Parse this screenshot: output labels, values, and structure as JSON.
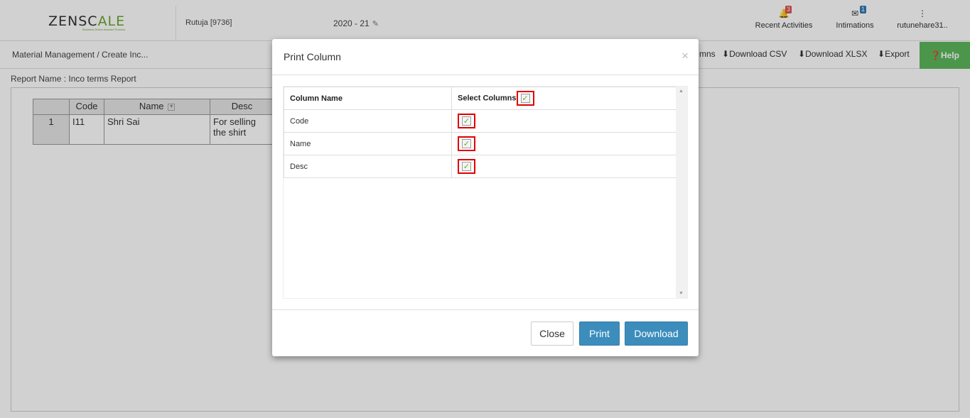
{
  "header": {
    "logo_prefix": "ZENSC",
    "logo_mid": "ALE",
    "logo_tagline": "Business Driven Assured Process",
    "user": "Rutuja [9736]",
    "year": "2020 - 21",
    "nav": {
      "recent_activities": "Recent Activities",
      "recent_count": "3",
      "intimations": "Intimations",
      "intimations_count": "1",
      "account": "rutunehare31.."
    }
  },
  "subbar": {
    "breadcrumb": "Material Management  / Create Inc...",
    "columns_partial": "mns",
    "download_csv": "Download CSV",
    "download_xlsx": "Download XLSX",
    "export": "Export",
    "help": "Help"
  },
  "report": {
    "name_label": "Report Name : Inco terms Report",
    "headers": [
      "Code",
      "Name",
      "Desc"
    ],
    "rows": [
      {
        "index": "1",
        "code": "I11",
        "name": "Shri Sai",
        "desc": "For selling the shirt"
      }
    ]
  },
  "modal": {
    "title": "Print Column",
    "close_symbol": "×",
    "col_header": "Column Name",
    "select_header": "Select Columns",
    "columns": [
      {
        "name": "Code",
        "checked": true
      },
      {
        "name": "Name",
        "checked": true
      },
      {
        "name": "Desc",
        "checked": true
      }
    ],
    "close_label": "Close",
    "print_label": "Print",
    "download_label": "Download"
  },
  "colors": {
    "accent": "#3c8dbc",
    "help_green": "#5cb85c",
    "highlight_red": "#e00000"
  }
}
